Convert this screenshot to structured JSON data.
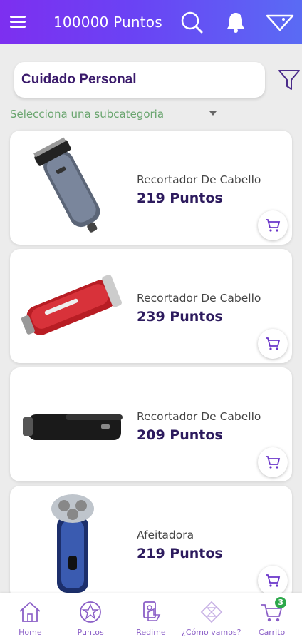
{
  "header": {
    "points_label": "100000 Puntos",
    "icons": [
      "menu-icon",
      "search-icon",
      "bell-icon",
      "dropdown-icon"
    ]
  },
  "category": {
    "selected": "Cuidado Personal",
    "subcategory_placeholder": "Selecciona una subcategoria"
  },
  "products": [
    {
      "name": "Recortador De Cabello",
      "price": "219 Puntos",
      "image": "hair-clipper-gray"
    },
    {
      "name": "Recortador De Cabello",
      "price": "239 Puntos",
      "image": "hair-clipper-red"
    },
    {
      "name": "Recortador De Cabello",
      "price": "209 Puntos",
      "image": "hair-trimmer-black"
    },
    {
      "name": "Afeitadora",
      "price": "219 Puntos",
      "image": "rotary-shaver"
    }
  ],
  "nav": {
    "items": [
      {
        "label": "Home",
        "icon": "home-icon"
      },
      {
        "label": "Puntos",
        "icon": "points-icon"
      },
      {
        "label": "Redime",
        "icon": "redeem-icon"
      },
      {
        "label": "¿Cómo vamos?",
        "icon": "progress-icon"
      },
      {
        "label": "Carrito",
        "icon": "cart-icon"
      }
    ],
    "cart_count": "3"
  },
  "colors": {
    "header_start": "#7d2ff0",
    "header_end": "#5a6bf4",
    "accent": "#6a35c9",
    "price": "#2d1b5e",
    "subcategory": "#6aa56f",
    "badge": "#2ca84a"
  }
}
